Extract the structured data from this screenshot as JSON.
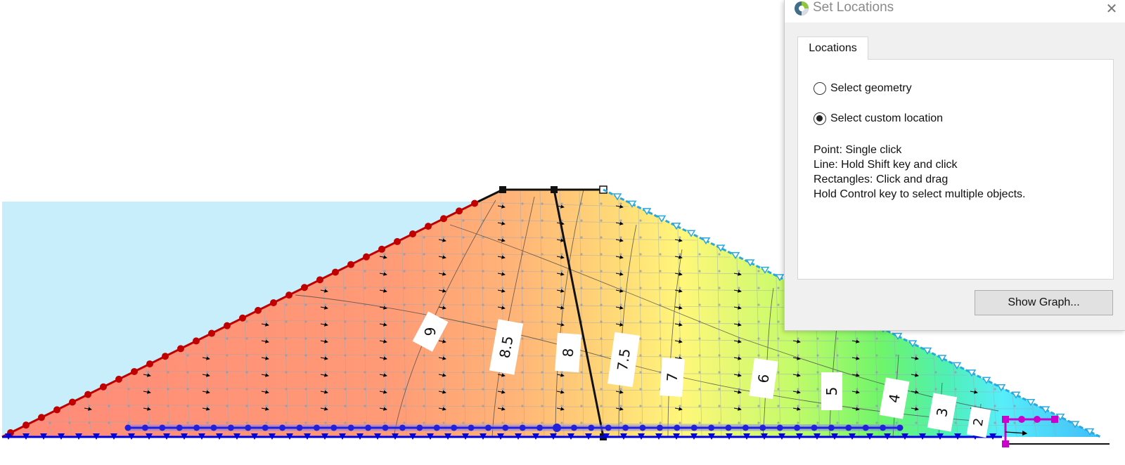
{
  "dialog": {
    "title": "Set Locations",
    "close_icon": "close-icon",
    "tab_label": "Locations",
    "options": [
      {
        "label": "Select geometry",
        "selected": false
      },
      {
        "label": "Select custom location",
        "selected": true
      }
    ],
    "instructions": [
      "Point: Single click",
      "Line: Hold Shift key and click",
      "Rectangles: Click and drag",
      "Hold Control key to select multiple objects."
    ],
    "show_graph_label": "Show Graph..."
  },
  "model": {
    "contour_labels": [
      "9",
      "8.5",
      "8",
      "7.5",
      "7",
      "6",
      "5",
      "4",
      "3",
      "2"
    ],
    "colors": {
      "reservoir": "#c8eefc",
      "upstream_boundary": "#c00000",
      "base_boundary": "#0000dd",
      "downstream_boundary": "#29a8e0",
      "selection_line": "#2020dd",
      "drain": "#cc00cc"
    }
  }
}
